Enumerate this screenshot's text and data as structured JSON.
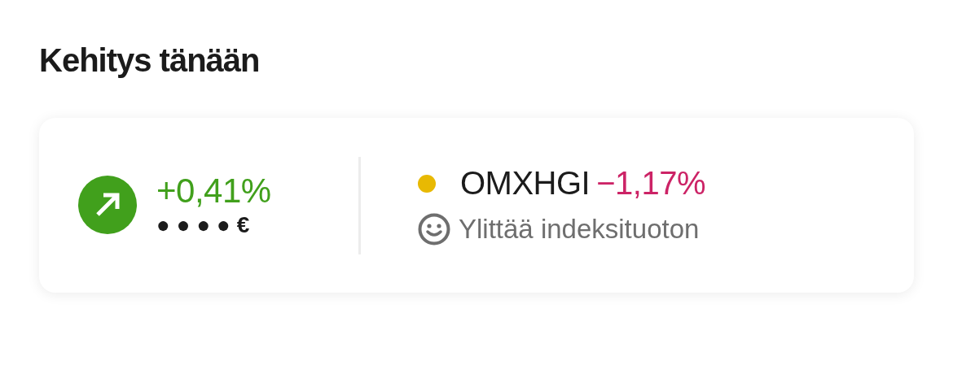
{
  "title": "Kehitys tänään",
  "portfolio": {
    "change": "+0,41%",
    "positive": true,
    "value": "● ● ● ● €"
  },
  "index": {
    "name": "OMXHGI",
    "color": "#e8b903",
    "change": "−1,17%",
    "positive": false,
    "comparison": "Ylittää indeksituoton"
  }
}
